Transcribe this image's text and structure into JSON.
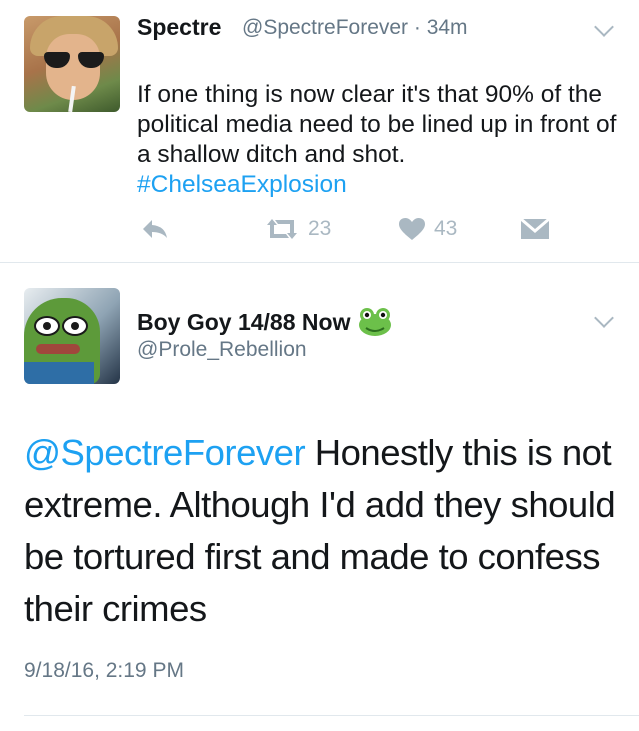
{
  "tweet1": {
    "name": "Spectre",
    "handle_time": "@SpectreForever · 34m",
    "text": "If one thing is now clear it's that 90% of the political media need to be lined up in front of a shallow ditch and shot. ",
    "hashtag": "#ChelseaExplosion",
    "retweets": "23",
    "likes": "43"
  },
  "tweet2": {
    "name": "Boy Goy 14/88 Now",
    "handle": "@Prole_Rebellion",
    "mention": "@SpectreForever",
    "text": " Honestly this is not extreme. Although I'd add they should be tortured first and made to confess their crimes",
    "timestamp": "9/18/16, 2:19 PM"
  },
  "colors": {
    "link": "#1da1f2",
    "muted": "#657786",
    "icon": "#aab8c2"
  },
  "icons": [
    "reply-icon",
    "retweet-icon",
    "heart-icon",
    "message-icon",
    "chevron-down-icon",
    "frog-emoji-icon"
  ]
}
